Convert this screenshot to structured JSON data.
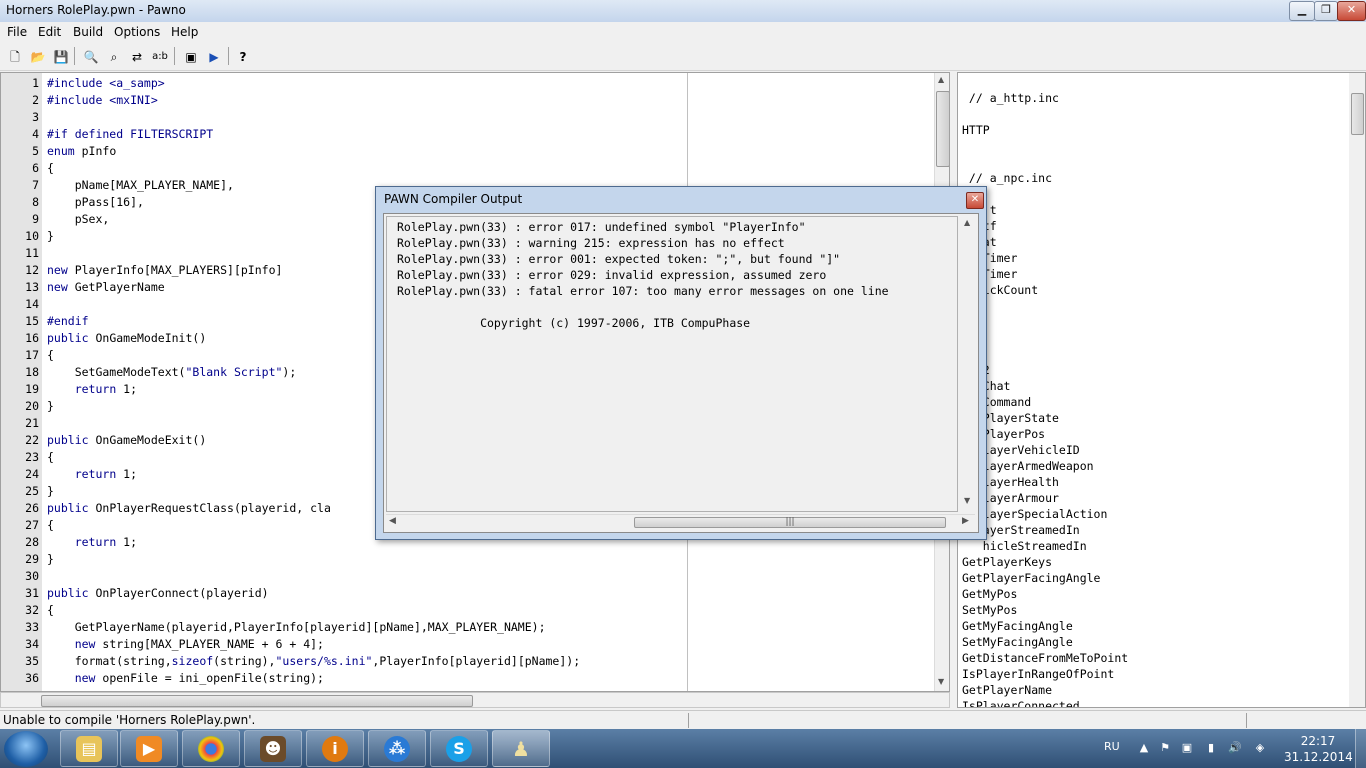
{
  "window": {
    "title": "Horners RolePlay.pwn - Pawno"
  },
  "menu": [
    "File",
    "Edit",
    "Build",
    "Options",
    "Help"
  ],
  "toolbar": {
    "buttons": [
      "new-file",
      "open-file",
      "save-file",
      "find",
      "find-next",
      "replace",
      "goto-line",
      "font",
      "compile",
      "help"
    ]
  },
  "editor": {
    "lines": [
      {
        "n": "1",
        "t": "#include <a_samp>"
      },
      {
        "n": "2",
        "t": "#include <mxINI>"
      },
      {
        "n": "3",
        "t": ""
      },
      {
        "n": "4",
        "t": "#if defined FILTERSCRIPT"
      },
      {
        "n": "5",
        "t": "enum pInfo"
      },
      {
        "n": "6",
        "t": "{"
      },
      {
        "n": "7",
        "t": "    pName[MAX_PLAYER_NAME],"
      },
      {
        "n": "8",
        "t": "    pPass[16],"
      },
      {
        "n": "9",
        "t": "    pSex,"
      },
      {
        "n": "10",
        "t": "}"
      },
      {
        "n": "11",
        "t": ""
      },
      {
        "n": "12",
        "t": "new PlayerInfo[MAX_PLAYERS][pInfo]"
      },
      {
        "n": "13",
        "t": "new GetPlayerName"
      },
      {
        "n": "14",
        "t": ""
      },
      {
        "n": "15",
        "t": "#endif"
      },
      {
        "n": "16",
        "t": "public OnGameModeInit()"
      },
      {
        "n": "17",
        "t": "{"
      },
      {
        "n": "18",
        "t": "    SetGameModeText(\"Blank Script\");"
      },
      {
        "n": "19",
        "t": "    return 1;"
      },
      {
        "n": "20",
        "t": "}"
      },
      {
        "n": "21",
        "t": ""
      },
      {
        "n": "22",
        "t": "public OnGameModeExit()"
      },
      {
        "n": "23",
        "t": "{"
      },
      {
        "n": "24",
        "t": "    return 1;"
      },
      {
        "n": "25",
        "t": "}"
      },
      {
        "n": "26",
        "t": "public OnPlayerRequestClass(playerid, cla"
      },
      {
        "n": "27",
        "t": "{"
      },
      {
        "n": "28",
        "t": "    return 1;"
      },
      {
        "n": "29",
        "t": "}"
      },
      {
        "n": "30",
        "t": ""
      },
      {
        "n": "31",
        "t": "public OnPlayerConnect(playerid)"
      },
      {
        "n": "32",
        "t": "{"
      },
      {
        "n": "33",
        "t": "    GetPlayerName(playerid,PlayerInfo[playerid][pName],MAX_PLAYER_NAME);"
      },
      {
        "n": "34",
        "t": "    new string[MAX_PLAYER_NAME + 6 + 4];"
      },
      {
        "n": "35",
        "t": "    format(string,sizeof(string),\"users/%s.ini\",PlayerInfo[playerid][pName]);"
      },
      {
        "n": "36",
        "t": "    new openFile = ini_openFile(string);"
      }
    ]
  },
  "right_panel": {
    "lines": [
      "",
      " // a_http.inc",
      "",
      "HTTP",
      "",
      "",
      " // a_npc.inc",
      "",
      "    t",
      "   tf",
      "   at",
      "   Timer",
      "   Timer",
      "   ickCount",
      "",
      "",
      "",
      "",
      "   2",
      "   Chat",
      "   Command",
      "   PlayerState",
      "   PlayerPos",
      "   layerVehicleID",
      "   layerArmedWeapon",
      "   layerHealth",
      "   layerArmour",
      "   layerSpecialAction",
      "   ayerStreamedIn",
      "   hicleStreamedIn",
      "GetPlayerKeys",
      "GetPlayerFacingAngle",
      "GetMyPos",
      "SetMyPos",
      "GetMyFacingAngle",
      "SetMyFacingAngle",
      "GetDistanceFromMeToPoint",
      "IsPlayerInRangeOfPoint",
      "GetPlayerName",
      "IsPlayerConnected",
      "StartRecordingPlayback"
    ]
  },
  "dialog": {
    "title": "PAWN Compiler Output",
    "messages": [
      "RolePlay.pwn(33) : error 017: undefined symbol \"PlayerInfo\"",
      "RolePlay.pwn(33) : warning 215: expression has no effect",
      "RolePlay.pwn(33) : error 001: expected token: \";\", but found \"]\"",
      "RolePlay.pwn(33) : error 029: invalid expression, assumed zero",
      "RolePlay.pwn(33) : fatal error 107: too many error messages on one line",
      "",
      "            Copyright (c) 1997-2006, ITB CompuPhase"
    ]
  },
  "statusbar": {
    "text": "Unable to compile 'Horners RolePlay.pwn'."
  },
  "taskbar": {
    "apps": [
      "explorer",
      "media-player",
      "chrome",
      "gta-sa",
      "info-app",
      "network-app",
      "skype",
      "pawno"
    ],
    "tray_lang": "RU",
    "time": "22:17",
    "date": "31.12.2014"
  }
}
